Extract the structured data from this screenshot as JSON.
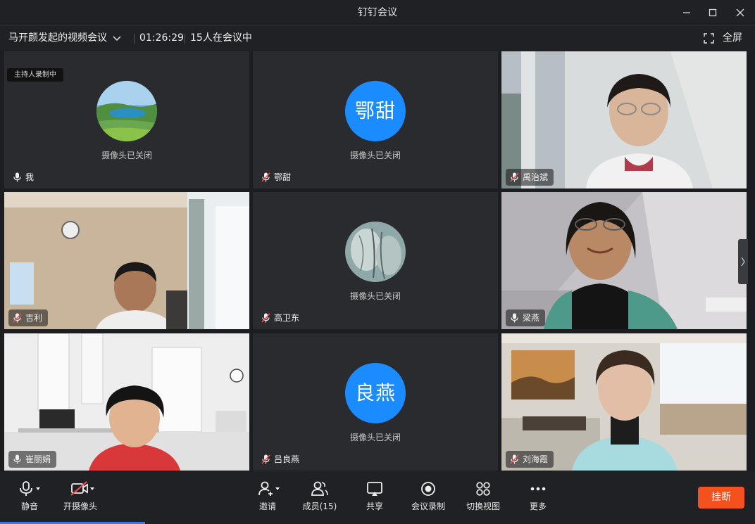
{
  "window": {
    "title": "钉钉会议"
  },
  "info": {
    "meeting_name": "马开颜发起的视频会议",
    "timer": "01:26:29",
    "participants": "15人在会议中",
    "fullscreen": "全屏"
  },
  "recording_badge": "主持人录制中",
  "camera_off_text": "摄像头已关闭",
  "tiles": [
    {
      "name": "我",
      "mic": "on",
      "avatar": "landscape",
      "avatar_text": ""
    },
    {
      "name": "鄂甜",
      "mic": "off",
      "avatar": "text",
      "avatar_text": "鄂甜"
    },
    {
      "name": "禹治斌",
      "mic": "off",
      "avatar": "video",
      "avatar_text": ""
    },
    {
      "name": "吉利",
      "mic": "off",
      "avatar": "video",
      "avatar_text": ""
    },
    {
      "name": "高卫东",
      "mic": "off",
      "avatar": "photo",
      "avatar_text": ""
    },
    {
      "name": "梁燕",
      "mic": "on",
      "avatar": "video",
      "avatar_text": ""
    },
    {
      "name": "崔丽娟",
      "mic": "on",
      "avatar": "video",
      "avatar_text": ""
    },
    {
      "name": "吕良燕",
      "mic": "off",
      "avatar": "text",
      "avatar_text": "良燕"
    },
    {
      "name": "刘海霞",
      "mic": "off",
      "avatar": "video",
      "avatar_text": ""
    }
  ],
  "toolbar": {
    "mute": "静音",
    "camera": "开摄像头",
    "invite": "邀请",
    "members": "成员(15)",
    "share": "共享",
    "record": "会议录制",
    "switch_view": "切换视图",
    "more": "更多",
    "hangup": "挂断"
  },
  "colors": {
    "accent": "#1a8cff",
    "hangup": "#f4511e",
    "background": "#1c1d20",
    "tile": "#2a2b2e"
  }
}
